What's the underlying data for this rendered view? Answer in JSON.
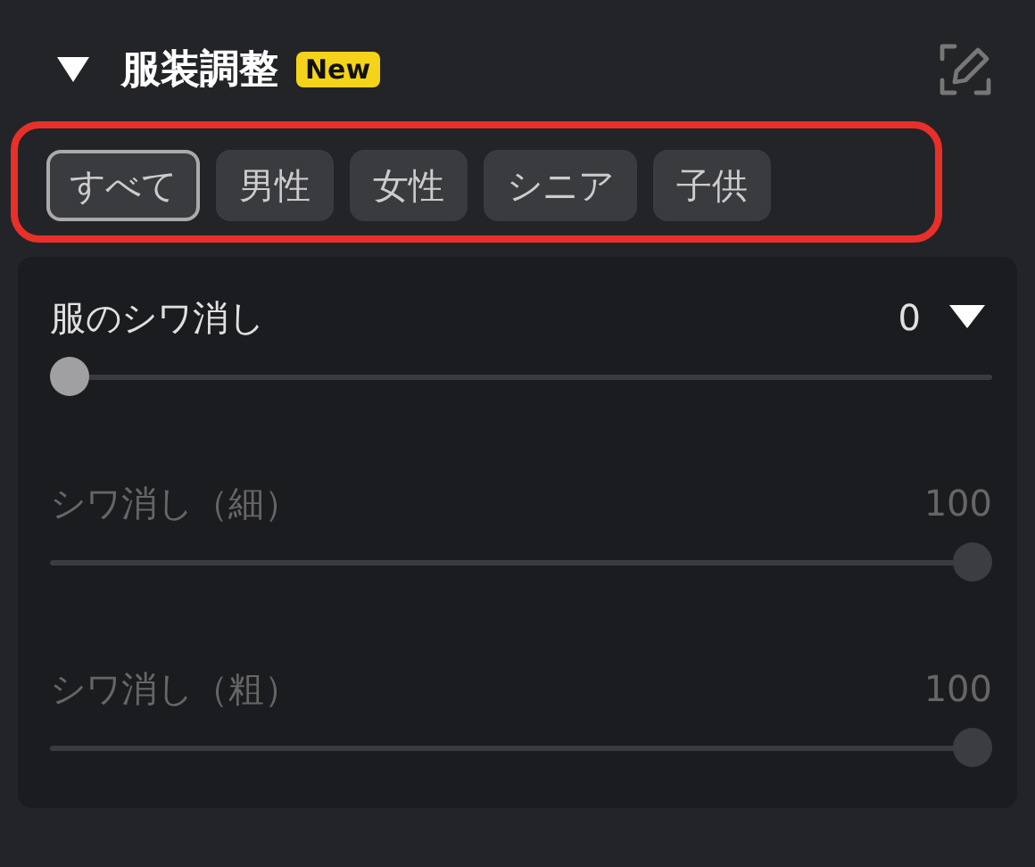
{
  "section": {
    "title": "服装調整",
    "badge": "New",
    "expanded": true
  },
  "filters": [
    {
      "label": "すべて",
      "selected": true
    },
    {
      "label": "男性",
      "selected": false
    },
    {
      "label": "女性",
      "selected": false
    },
    {
      "label": "シニア",
      "selected": false
    },
    {
      "label": "子供",
      "selected": false
    }
  ],
  "sliders": [
    {
      "label": "服のシワ消し",
      "value": "0",
      "level": 0,
      "disabled": false,
      "dropdown": true
    },
    {
      "label": "シワ消し（細）",
      "value": "100",
      "level": 1,
      "disabled": true,
      "dropdown": false
    },
    {
      "label": "シワ消し（粗）",
      "value": "100",
      "level": 1,
      "disabled": true,
      "dropdown": false
    }
  ]
}
